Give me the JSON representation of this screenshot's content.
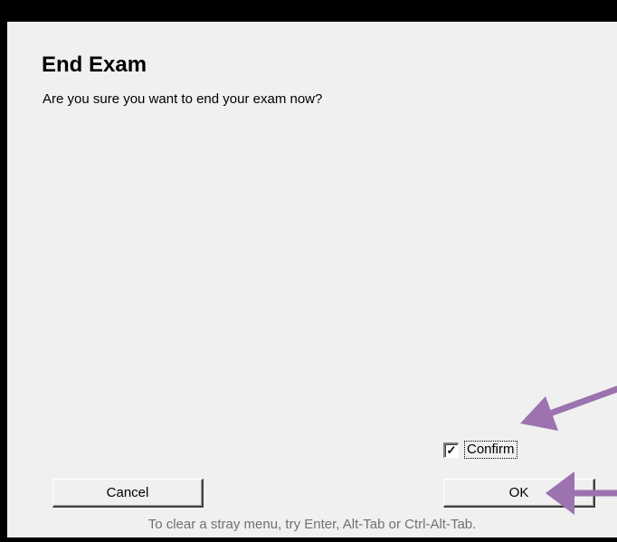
{
  "dialog": {
    "title": "End Exam",
    "message": "Are you sure you want to end your exam now?",
    "confirm": {
      "label": "Confirm",
      "checked": true,
      "check_glyph": "✓"
    },
    "cancel_label": "Cancel",
    "ok_label": "OK",
    "hint": "To clear a stray menu, try Enter, Alt-Tab or Ctrl-Alt-Tab."
  },
  "annotations": {
    "arrow_color": "#9c72b0",
    "arrows": [
      "arrow-to-confirm",
      "arrow-to-ok"
    ]
  }
}
